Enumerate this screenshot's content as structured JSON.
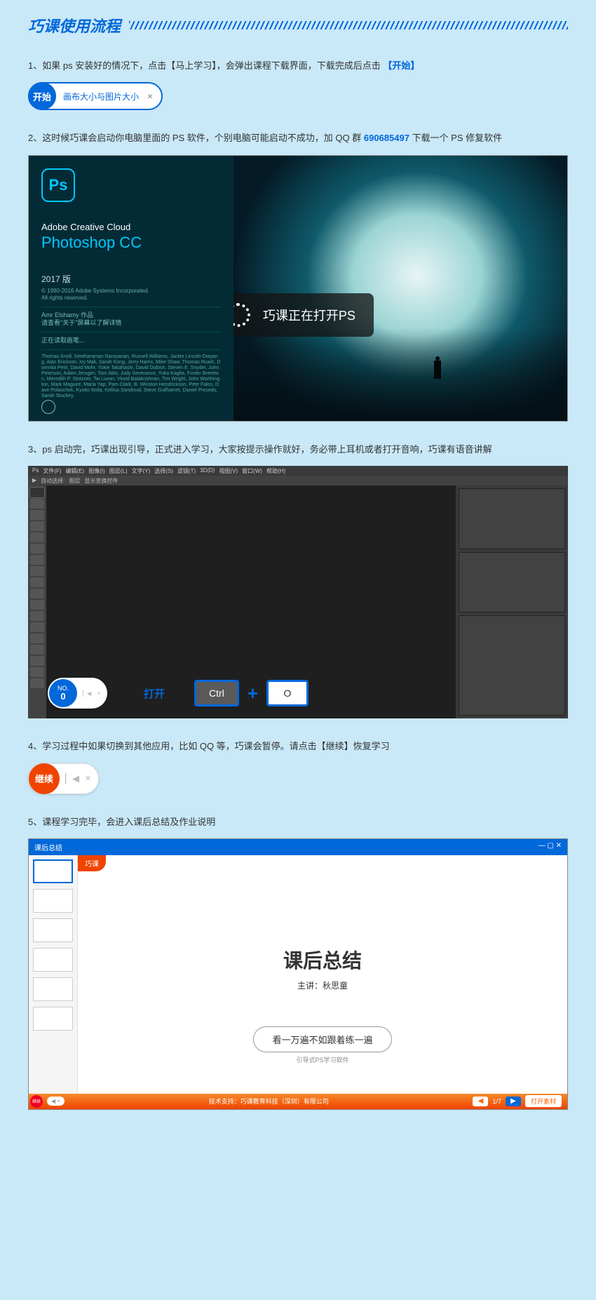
{
  "title": "巧课使用流程",
  "steps": {
    "s1": {
      "num": "1、",
      "text": "如果 ps 安装好的情况下，点击【马上学习】，会弹出课程下载界面，下载完成后点击",
      "link": "【开始】"
    },
    "s2": {
      "num": "2、",
      "text": "这时候巧课会启动你电脑里面的 PS 软件，个别电脑可能启动不成功，加 QQ 群 ",
      "qq": "690685497",
      "text2": " 下载一个 PS 修复软件"
    },
    "s3": {
      "num": "3、",
      "text": "ps 启动完，巧课出现引导，正式进入学习，大家按提示操作就好，务必带上耳机或者打开音响，巧课有语音讲解"
    },
    "s4": {
      "num": "4、",
      "text": "学习过程中如果切换到其他应用，比如 QQ 等，巧课会暂停。请点击【继续】恢复学习"
    },
    "s5": {
      "num": "5、",
      "text": "课程学习完毕，会进入课后总结及作业说明"
    }
  },
  "pill1": {
    "lead": "开始",
    "mid": "画布大小与图片大小",
    "x": "×"
  },
  "splash": {
    "ps": "Ps",
    "cloud1": "Adobe Creative Cloud",
    "cloud2": "Photoshop CC",
    "ver": "2017 版",
    "copy1": "© 1990-2016 Adobe Systems Incorporated.",
    "copy2": "All rights reserved.",
    "author": "Amr Elshamy 作品",
    "see": "请查看\"关于\"屏幕以了解详情",
    "reading": "正在读取画笔...",
    "credits": "Thomas Knoll, Seetharaman Narayanan, Russell Williams, Jackie Lincoln-Owyang, Alan Erickson, Ivy Mak, Sarah Kong, Jerry Harris, Mike Shaw, Thomas Ruark, Domnita Petri, David Mohr, Yukie Takahashi, David Dobish, Steven E. Snyder, John Peterson, Adam Jerugim, Tom Attix, Judy Severance, Yuko Kagita, Foster Brereton, Meredith P. Stotzner, Tai Luxon, Vinod Balakrishnan, Tim Wright, John Worthington, Mark Maguire, Maria Yap, Pam Clark, B. Winston Hendrickson, Pete Falco, Dave Polaschek, Kyoko Itoda, Kellisa Sandoval, Steve Guilhamet, Daniel Presedo, Sarah Stuckey,",
    "overlay": "巧课正在打开PS"
  },
  "psui": {
    "menu": [
      "Ps",
      "文件(F)",
      "编辑(E)",
      "图像(I)",
      "图层(L)",
      "文字(Y)",
      "选择(S)",
      "滤镜(T)",
      "3D(D)",
      "视图(V)",
      "窗口(W)",
      "帮助(H)"
    ],
    "opt": [
      "▶",
      "自动选择:",
      "图层",
      "显示变换控件"
    ],
    "no": "NO.",
    "zero": "0",
    "open": "打开",
    "ctrl": "Ctrl",
    "plus": "+",
    "o": "O"
  },
  "pill4": {
    "lead": "继续",
    "x": "×"
  },
  "summary": {
    "winTitle": "课后总结",
    "winCtl": "— ▢ ✕",
    "logo": "巧课",
    "h": "课后总结",
    "sub": "主讲：秋思童",
    "cta": "看一万遍不如跟着练一遍",
    "ctaSub": "引导式PS学习软件",
    "status": "ws-left",
    "tech": "技术支持：巧课教育科技（深圳）有限公司",
    "badge": "继续",
    "page": "1/7",
    "open": "打开素材"
  }
}
